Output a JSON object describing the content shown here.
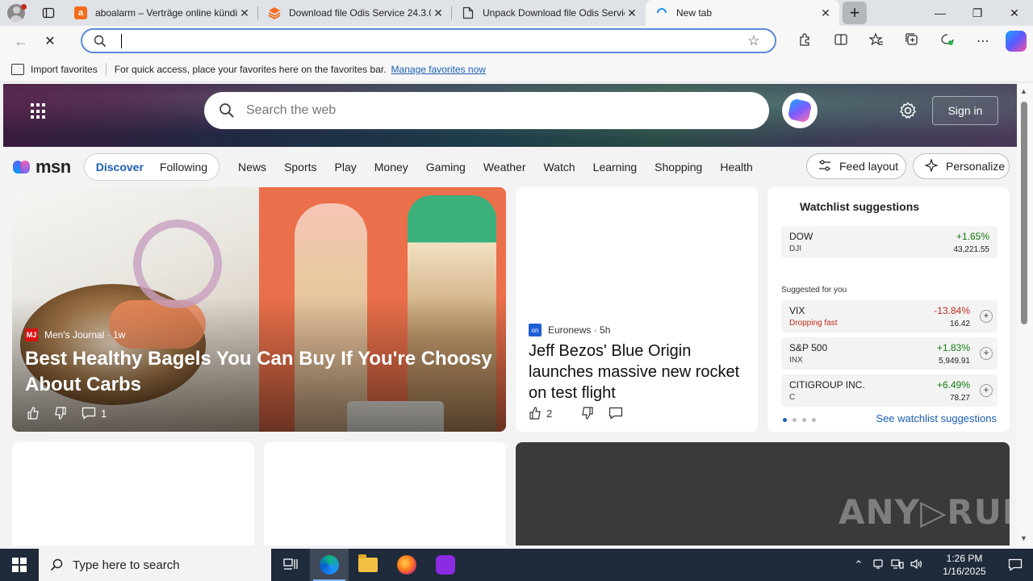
{
  "browser": {
    "tabs": [
      {
        "title": "aboalarm – Verträge online kündi",
        "fav": "a",
        "fav_color": "#f56a1d"
      },
      {
        "title": "Download file Odis Service 24.3.0",
        "fav": "",
        "fav_color": "#f26b1d"
      },
      {
        "title": "Unpack Download file Odis Servic",
        "fav": "",
        "fav_color": "#ffffff"
      },
      {
        "title": "New tab",
        "fav": "",
        "fav_color": "#1e90ff"
      }
    ],
    "address_value": "",
    "favorites_bar": {
      "import_label": "Import favorites",
      "hint": "For quick access, place your favorites here on the favorites bar.",
      "manage_link": "Manage favorites now"
    }
  },
  "msn": {
    "search_placeholder": "Search the web",
    "sign_in": "Sign in",
    "logo_text": "msn",
    "pills": [
      "Discover",
      "Following"
    ],
    "nav": [
      "News",
      "Sports",
      "Play",
      "Money",
      "Gaming",
      "Weather",
      "Watch",
      "Learning",
      "Shopping",
      "Health"
    ],
    "feed_layout": "Feed layout",
    "personalize": "Personalize",
    "hero_card": {
      "source": "Men's Journal",
      "age": "1w",
      "headline": "Best Healthy Bagels You Can Buy If You're Choosy About Carbs",
      "comments": "1"
    },
    "news_card": {
      "source": "Euronews",
      "age": "5h",
      "headline": "Jeff Bezos' Blue Origin launches massive new rocket on test flight",
      "likes": "2"
    },
    "watchlist": {
      "title": "Watchlist suggestions",
      "suggested_label": "Suggested for you",
      "see_link": "See watchlist suggestions",
      "top": {
        "symbol": "DOW",
        "sub": "DJI",
        "change": "+1.65%",
        "price": "43,221.55"
      },
      "stocks": [
        {
          "symbol": "VIX",
          "sub": "Dropping fast",
          "change": "-13.84%",
          "price": "16.42"
        },
        {
          "symbol": "S&P 500",
          "sub": "INX",
          "change": "+1.83%",
          "price": "5,949.91"
        },
        {
          "symbol": "CITIGROUP INC.",
          "sub": "C",
          "change": "+6.49%",
          "price": "78.27"
        }
      ]
    },
    "watermark": "ANY▷RUN"
  },
  "taskbar": {
    "search_placeholder": "Type here to search",
    "time": "1:26 PM",
    "date": "1/16/2025"
  },
  "colors": {
    "accent": "#1a5fb4",
    "up": "#107c10",
    "down": "#c42b1c"
  }
}
